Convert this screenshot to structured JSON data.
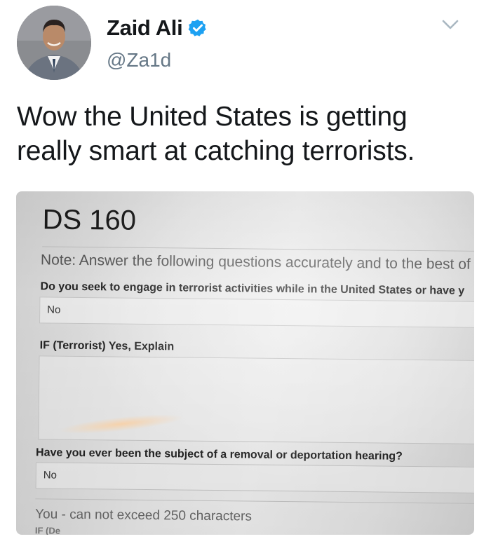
{
  "tweet": {
    "display_name": "Zaid Ali",
    "handle": "@Za1d",
    "text_line1": "Wow the United States is getting",
    "text_line2": "really smart at catching terrorists.",
    "colors": {
      "verified": "#1da1f2",
      "text": "#14171a",
      "handle": "#657786"
    }
  },
  "icons": {
    "verified": "verified-badge-icon",
    "more": "chevron-down-icon",
    "avatar": "profile-photo"
  },
  "photo": {
    "form_title": "DS 160",
    "note": "Note: Answer the following questions accurately and to the best of",
    "q1": "Do you seek to engage in terrorist activities while in the United States or have y",
    "a1": "No",
    "q2": "IF (Terrorist) Yes, Explain",
    "q3": "Have you ever been the subject of a removal or deportation hearing?",
    "a2": "No",
    "hint": "You - can not exceed 250 characters",
    "cutoff": "IF (De"
  }
}
